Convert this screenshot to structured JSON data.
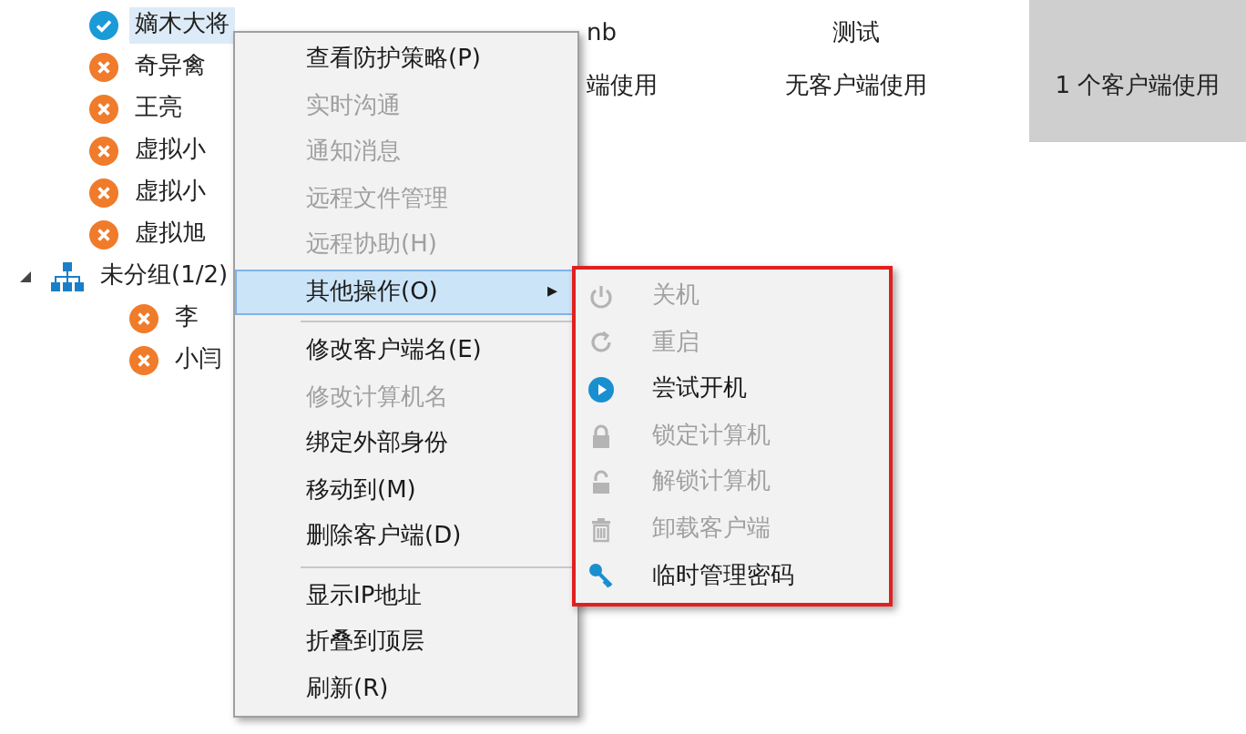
{
  "tree": [
    {
      "label": "嫡木大将",
      "kind": "online",
      "selected": true
    },
    {
      "label": "奇异禽",
      "kind": "offline",
      "selected": false
    },
    {
      "label": "王亮",
      "kind": "offline",
      "selected": false
    },
    {
      "label": "虚拟小",
      "kind": "offline",
      "selected": false
    },
    {
      "label": "虚拟小",
      "kind": "offline",
      "selected": false
    },
    {
      "label": "虚拟旭",
      "kind": "offline",
      "selected": false
    },
    {
      "label": "未分组(1/2)",
      "kind": "group",
      "expanded": true,
      "selected": false,
      "children": [
        {
          "label": "李",
          "kind": "offline",
          "selected": false
        },
        {
          "label": "小闫",
          "kind": "offline",
          "selected": false
        }
      ]
    }
  ],
  "columns": [
    {
      "header": "nb",
      "usage": "端使用",
      "selected": false
    },
    {
      "header": "测试",
      "usage": "无客户端使用",
      "selected": false
    },
    {
      "usage": "1 个客户端使用",
      "selected": true
    }
  ],
  "context_menu": [
    {
      "kind": "item",
      "label": "查看防护策略(P)",
      "disabled": false
    },
    {
      "kind": "item",
      "label": "实时沟通",
      "disabled": true
    },
    {
      "kind": "item",
      "label": "通知消息",
      "disabled": true
    },
    {
      "kind": "item",
      "label": "远程文件管理",
      "disabled": true
    },
    {
      "kind": "item",
      "label": "远程协助(H)",
      "disabled": true
    },
    {
      "kind": "submenu",
      "label": "其他操作(O)",
      "arrow": "▸",
      "disabled": false,
      "selected": true
    },
    {
      "kind": "separator"
    },
    {
      "kind": "item",
      "label": "修改客户端名(E)",
      "disabled": false
    },
    {
      "kind": "item",
      "label": "修改计算机名",
      "disabled": true
    },
    {
      "kind": "item",
      "label": "绑定外部身份",
      "disabled": false
    },
    {
      "kind": "item",
      "label": "移动到(M)",
      "disabled": false
    },
    {
      "kind": "item",
      "label": "删除客户端(D)",
      "disabled": false
    },
    {
      "kind": "separator"
    },
    {
      "kind": "item",
      "label": "显示IP地址",
      "disabled": false
    },
    {
      "kind": "item",
      "label": "折叠到顶层",
      "disabled": false
    },
    {
      "kind": "item",
      "label": "刷新(R)",
      "disabled": false
    }
  ],
  "submenu": [
    {
      "label": "关机",
      "disabled": true
    },
    {
      "label": "重启",
      "disabled": true
    },
    {
      "label": "尝试开机",
      "disabled": false
    },
    {
      "label": "锁定计算机",
      "disabled": true
    },
    {
      "label": "解锁计算机",
      "disabled": true
    },
    {
      "label": "卸载客户端",
      "disabled": true
    },
    {
      "label": "临时管理密码",
      "disabled": false
    }
  ]
}
